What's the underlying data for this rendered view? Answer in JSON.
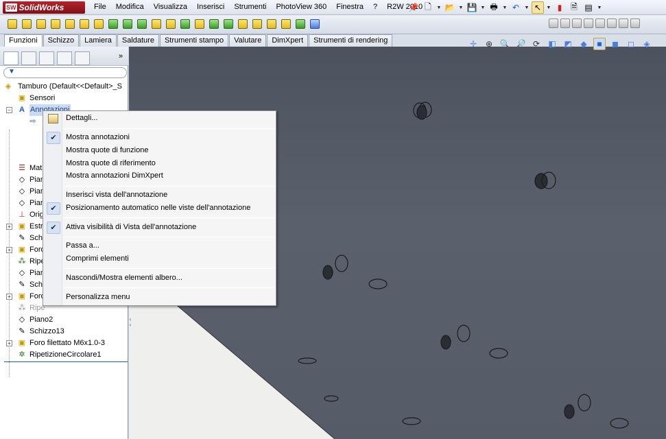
{
  "app": {
    "name": "SolidWorks",
    "logo_mark": "SW"
  },
  "menubar": {
    "items": [
      "File",
      "Modifica",
      "Visualizza",
      "Inserisci",
      "Strumenti",
      "PhotoView 360",
      "Finestra",
      "?",
      "R2W 2010"
    ]
  },
  "tabs": {
    "items": [
      {
        "label": "Funzioni",
        "active": true
      },
      {
        "label": "Schizzo",
        "active": false
      },
      {
        "label": "Lamiera",
        "active": false
      },
      {
        "label": "Saldature",
        "active": false
      },
      {
        "label": "Strumenti stampo",
        "active": false
      },
      {
        "label": "Valutare",
        "active": false
      },
      {
        "label": "DimXpert",
        "active": false
      },
      {
        "label": "Strumenti di rendering",
        "active": false
      }
    ]
  },
  "left_panel": {
    "more_glyph": "»",
    "filter_icon": "funnel-icon",
    "tree": [
      {
        "label": "Tamburo  (Default<<Default>_S",
        "icon": "part-icon"
      },
      {
        "label": "Sensori",
        "icon": "sensor-folder-icon"
      },
      {
        "label": "Annotazioni",
        "icon": "annotation-icon",
        "highlighted": true
      },
      {
        "label": "Mat",
        "icon": "material-icon"
      },
      {
        "label": "Pian",
        "icon": "plane-icon"
      },
      {
        "label": "Pian",
        "icon": "plane-icon"
      },
      {
        "label": "Pian",
        "icon": "plane-icon"
      },
      {
        "label": "Orig",
        "icon": "origin-icon"
      },
      {
        "label": "Estr",
        "icon": "extrude-icon"
      },
      {
        "label": "Sch",
        "icon": "sketch-icon"
      },
      {
        "label": "Foro",
        "icon": "hole-icon"
      },
      {
        "label": "Ripe",
        "icon": "pattern-icon"
      },
      {
        "label": "Pian",
        "icon": "plane-icon"
      },
      {
        "label": "Sch",
        "icon": "sketch-icon"
      },
      {
        "label": "Foro",
        "icon": "hole-icon"
      },
      {
        "label": "Ripe",
        "icon": "pattern-icon",
        "dim": true
      },
      {
        "label": "Piano2",
        "icon": "plane-icon"
      },
      {
        "label": "Schizzo13",
        "icon": "sketch-icon"
      },
      {
        "label": "Foro filettato M6x1.0-3",
        "icon": "hole-icon"
      },
      {
        "label": "RipetizioneCircolare1",
        "icon": "circular-pattern-icon"
      }
    ]
  },
  "context_menu": {
    "items": [
      {
        "label": "Dettagli...",
        "icon": "details-icon"
      },
      {
        "label": "Mostra annotazioni",
        "checked": true
      },
      {
        "label": "Mostra quote di funzione"
      },
      {
        "label": "Mostra quote di riferimento"
      },
      {
        "label": "Mostra annotazioni DimXpert"
      },
      {
        "label": "Inserisci vista dell'annotazione"
      },
      {
        "label": "Posizionamento automatico nelle viste dell'annotazione",
        "checked": true
      },
      {
        "label": "Attiva visibilità di Vista dell'annotazione",
        "checked": true
      },
      {
        "label": "Passa a..."
      },
      {
        "label": "Comprimi elementi"
      },
      {
        "label": "Nascondi/Mostra elementi albero..."
      },
      {
        "label": "Personalizza menu"
      }
    ],
    "check_glyph": "✔"
  },
  "colors": {
    "viewport_background": "#555b67",
    "part_face": "#f0f0ee",
    "menu_highlight": "#c9dbf4",
    "logo_red": "#b5242b"
  }
}
